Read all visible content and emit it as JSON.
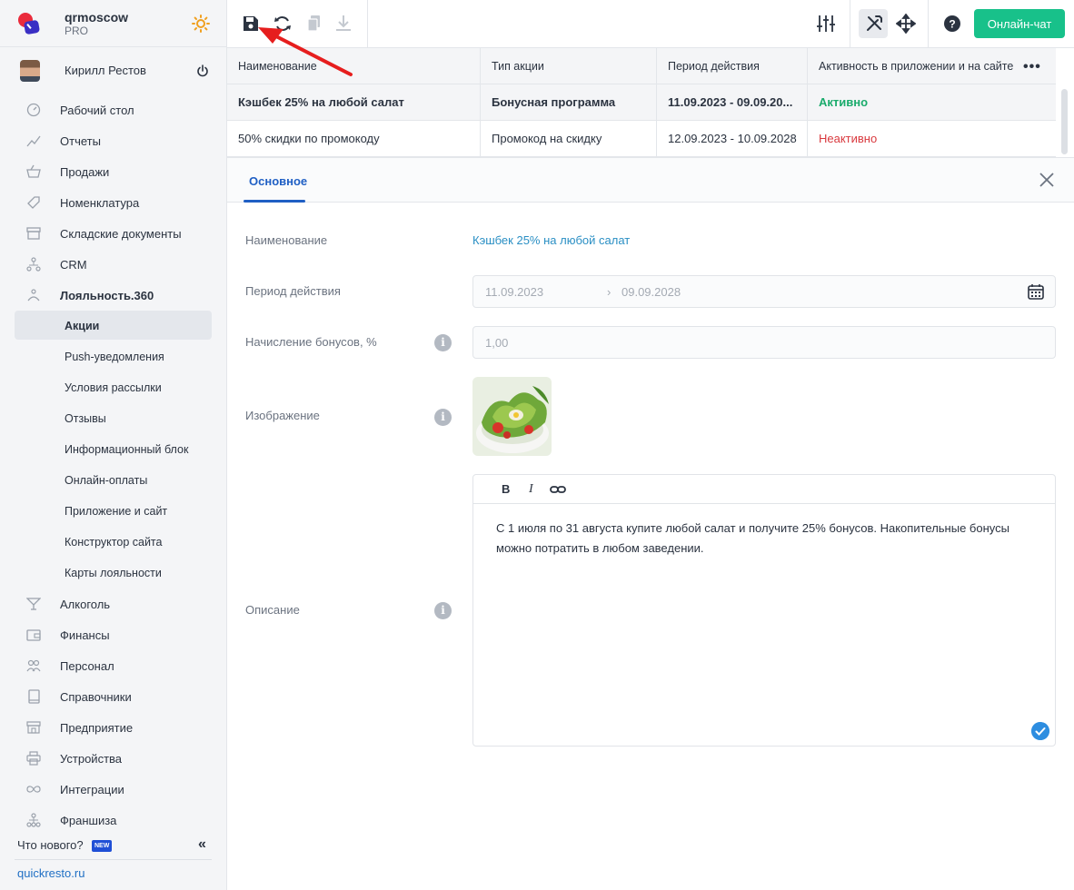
{
  "brand": {
    "name": "qrmoscow",
    "plan": "PRO"
  },
  "user": {
    "name": "Кирилл Рестов"
  },
  "nav": {
    "items": [
      {
        "label": "Рабочий стол"
      },
      {
        "label": "Отчеты"
      },
      {
        "label": "Продажи"
      },
      {
        "label": "Номенклатура"
      },
      {
        "label": "Складские документы"
      },
      {
        "label": "CRM"
      },
      {
        "label": "Лояльность.360"
      }
    ],
    "loyalty_sub": [
      {
        "label": "Акции"
      },
      {
        "label": "Push-уведомления"
      },
      {
        "label": "Условия рассылки"
      },
      {
        "label": "Отзывы"
      },
      {
        "label": "Информационный блок"
      },
      {
        "label": "Онлайн-оплаты"
      },
      {
        "label": "Приложение и сайт"
      },
      {
        "label": "Конструктор сайта"
      },
      {
        "label": "Карты лояльности"
      }
    ],
    "items_after": [
      {
        "label": "Алкоголь"
      },
      {
        "label": "Финансы"
      },
      {
        "label": "Персонал"
      },
      {
        "label": "Справочники"
      },
      {
        "label": "Предприятие"
      },
      {
        "label": "Устройства"
      },
      {
        "label": "Интеграции"
      },
      {
        "label": "Франшиза"
      }
    ]
  },
  "footer": {
    "whats_new": "Что нового?",
    "new_badge": "NEW",
    "site": "quickresto.ru"
  },
  "toolbar": {
    "chat_label": "Онлайн-чат"
  },
  "table": {
    "headers": [
      "Наименование",
      "Тип акции",
      "Период действия",
      "Активность в приложении и на сайте"
    ],
    "rows": [
      [
        "Кэшбек 25% на любой салат",
        "Бонусная программа",
        "11.09.2023 - 09.09.20...",
        "Активно"
      ],
      [
        "50% скидки по промокоду",
        "Промокод на скидку",
        "12.09.2023 - 10.09.2028",
        "Неактивно"
      ]
    ]
  },
  "detail": {
    "tab": "Основное",
    "name_label": "Наименование",
    "name_value": "Кэшбек 25% на любой салат",
    "period_label": "Период действия",
    "period_from": "11.09.2023",
    "period_sep": "›",
    "period_to": "09.09.2028",
    "bonus_label": "Начисление бонусов, %",
    "bonus_placeholder": "1,00",
    "image_label": "Изображение",
    "description_label": "Описание",
    "description_text": "С 1 июля по 31 августа купите любой салат и получите 25% бонусов. Накопительные бонусы можно потратить в любом заведении.",
    "editor_bold": "B",
    "editor_italic": "I"
  },
  "colors": {
    "accent": "#1f5fc4",
    "chat": "#18c18a",
    "active": "#1aab6c",
    "inactive": "#d9393e"
  }
}
